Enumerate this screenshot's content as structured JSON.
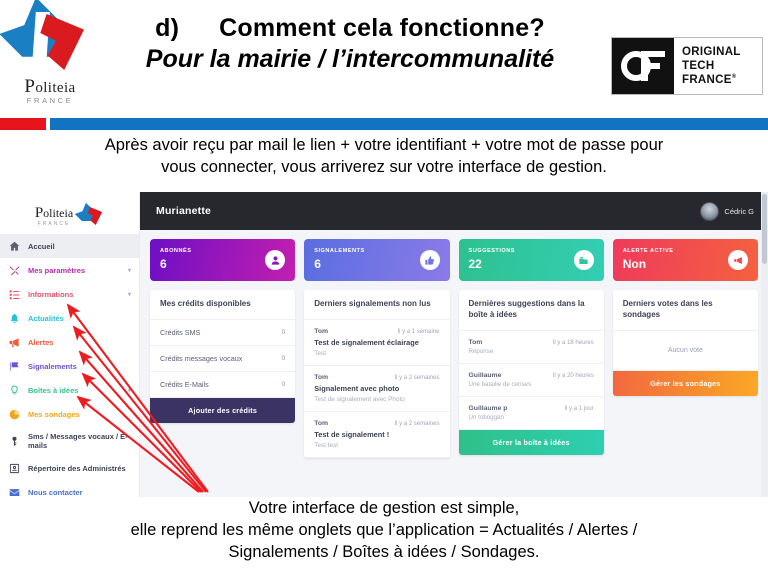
{
  "slide": {
    "header": {
      "logo_left": {
        "name": "Politeia",
        "word_first": "P",
        "word_rest": "oliteia",
        "subtitle": "FRANCE"
      },
      "title_marker": "d)",
      "title_line1": "Comment cela fonctionne?",
      "title_line2": "Pour la mairie / l’intercommunalité",
      "logo_right": {
        "mark": "OF",
        "line1": "ORIGINAL",
        "line2": "TECH",
        "line3": "FRANCE",
        "registered": "®"
      }
    },
    "intro_line1": "Après avoir reçu par mail le lien + votre identifiant + votre mot de passe pour",
    "intro_line2": "vous connecter, vous arriverez sur votre interface de gestion.",
    "footer_line1": "Votre interface de gestion est simple,",
    "footer_line2": "elle reprend les  même onglets que l’application = Actualités / Alertes /",
    "footer_line3": "Signalements / Boîtes à idées / Sondages."
  },
  "app": {
    "sidebar": {
      "logo": {
        "word_first": "P",
        "word_rest": "oliteia",
        "subtitle": "FRANCE"
      },
      "items": [
        {
          "label": "Accueil",
          "icon": "home-icon",
          "color": "#5b6175",
          "active": true,
          "caret": false
        },
        {
          "label": "Mes paramètres",
          "icon": "tools-icon",
          "color": "#b42fa8",
          "active": false,
          "caret": true
        },
        {
          "label": "Informations",
          "icon": "list-icon",
          "color": "#e8516e",
          "active": false,
          "caret": true
        },
        {
          "label": "Actualités",
          "icon": "bell-icon",
          "color": "#23c2d8",
          "active": false,
          "caret": false
        },
        {
          "label": "Alertes",
          "icon": "megaphone-icon",
          "color": "#f05a3c",
          "active": false,
          "caret": false
        },
        {
          "label": "Signalements",
          "icon": "flag-icon",
          "color": "#6f4fd8",
          "active": false,
          "caret": false
        },
        {
          "label": "Boîtes à idées",
          "icon": "lightbulb-icon",
          "color": "#36c28e",
          "active": false,
          "caret": true
        },
        {
          "label": "Mes sondages",
          "icon": "chart-pie-icon",
          "color": "#f0a818",
          "active": false,
          "caret": false
        },
        {
          "label": "Sms / Messages vocaux / E-mails",
          "icon": "key-icon",
          "color": "#3d4356",
          "active": false,
          "caret": false
        },
        {
          "label": "Répertoire des Administrés",
          "icon": "id-card-icon",
          "color": "#3d4356",
          "active": false,
          "caret": false
        },
        {
          "label": "Nous contacter",
          "icon": "envelope-icon",
          "color": "#4b6fd0",
          "active": false,
          "caret": false
        }
      ]
    },
    "topbar": {
      "title": "Murianette",
      "username": "Cédric G",
      "avatar": "user-avatar"
    },
    "kpis": [
      {
        "label": "ABONNÉS",
        "value": "6",
        "icon": "user-icon",
        "color_from": "#6f0fc4",
        "color_to": "#c21fb0"
      },
      {
        "label": "SIGNALEMENTS",
        "value": "6",
        "icon": "thumb-up-icon",
        "color_from": "#5a6ee0",
        "color_to": "#8b7ae8"
      },
      {
        "label": "SUGGESTIONS",
        "value": "22",
        "icon": "inbox-icon",
        "color_from": "#2ec08f",
        "color_to": "#33cfb3"
      },
      {
        "label": "ALERTE ACTIVE",
        "value": "Non",
        "icon": "megaphone-icon",
        "color_from": "#ef3b5c",
        "color_to": "#f4613f"
      }
    ],
    "credits_card": {
      "title": "Mes crédits disponibles",
      "rows": [
        {
          "label": "Crédits SMS",
          "value": "0"
        },
        {
          "label": "Crédits messages vocaux",
          "value": "0"
        },
        {
          "label": "Crédits E-Mails",
          "value": "0"
        }
      ],
      "button": "Ajouter des crédits"
    },
    "reports_card": {
      "title": "Derniers signalements non lus",
      "items": [
        {
          "author": "Tom",
          "time": "Il y a 1 semaine",
          "title": "Test de signalement éclairage",
          "desc": "Test"
        },
        {
          "author": "Tom",
          "time": "Il y a 2 semaines",
          "title": "Signalement avec photo",
          "desc": "Test de signalement avec Photo"
        },
        {
          "author": "Tom",
          "time": "Il y a 2 semaines",
          "title": "Test de signalement !",
          "desc": "Test test"
        }
      ]
    },
    "ideas_card": {
      "title": "Dernières suggestions dans la boîte à idées",
      "items": [
        {
          "author": "Tom",
          "time": "Il y a 18 heures",
          "desc": "Réponse"
        },
        {
          "author": "Guillaume",
          "time": "Il y a 20 heures",
          "desc": "Une bataille de cerises"
        },
        {
          "author": "Guillaume p",
          "time": "Il y a 1 jour",
          "desc": "Un toboggan"
        }
      ],
      "button": "Gérer la boîte à idées"
    },
    "polls_card": {
      "title": "Derniers votes dans les sondages",
      "empty": "Aucun vote",
      "button": "Gérer les sondages"
    }
  },
  "annotations": {
    "arrow_color": "#ee1c20",
    "arrow_count": 5,
    "targets": [
      "Actualités",
      "Alertes",
      "Signalements",
      "Boîtes à idées",
      "Mes sondages"
    ]
  }
}
